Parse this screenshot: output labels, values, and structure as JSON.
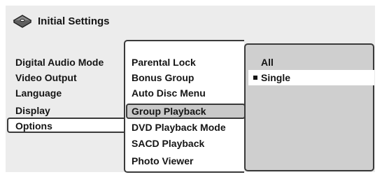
{
  "header": {
    "title": "Initial Settings",
    "icon": "disc-icon"
  },
  "main_menu": {
    "items": [
      {
        "label": "Digital Audio Mode"
      },
      {
        "label": "Video Output"
      },
      {
        "label": "Language"
      },
      {
        "label": "Display"
      },
      {
        "label": "Options",
        "selected": true
      }
    ]
  },
  "sub_menu": {
    "items": [
      {
        "label": "Parental  Lock"
      },
      {
        "label": "Bonus Group"
      },
      {
        "label": "Auto Disc Menu"
      },
      {
        "label": "Group Playback",
        "highlighted": true
      },
      {
        "label": "DVD Playback Mode"
      },
      {
        "label": "SACD Playback"
      },
      {
        "label": "Photo Viewer"
      }
    ]
  },
  "value_menu": {
    "items": [
      {
        "label": "All"
      },
      {
        "label": "Single",
        "current": true
      }
    ]
  },
  "colors": {
    "panel": "#ececec",
    "highlight": "#c9c9c9",
    "value_panel": "#cfcfcf",
    "border": "#3a3a3a"
  }
}
